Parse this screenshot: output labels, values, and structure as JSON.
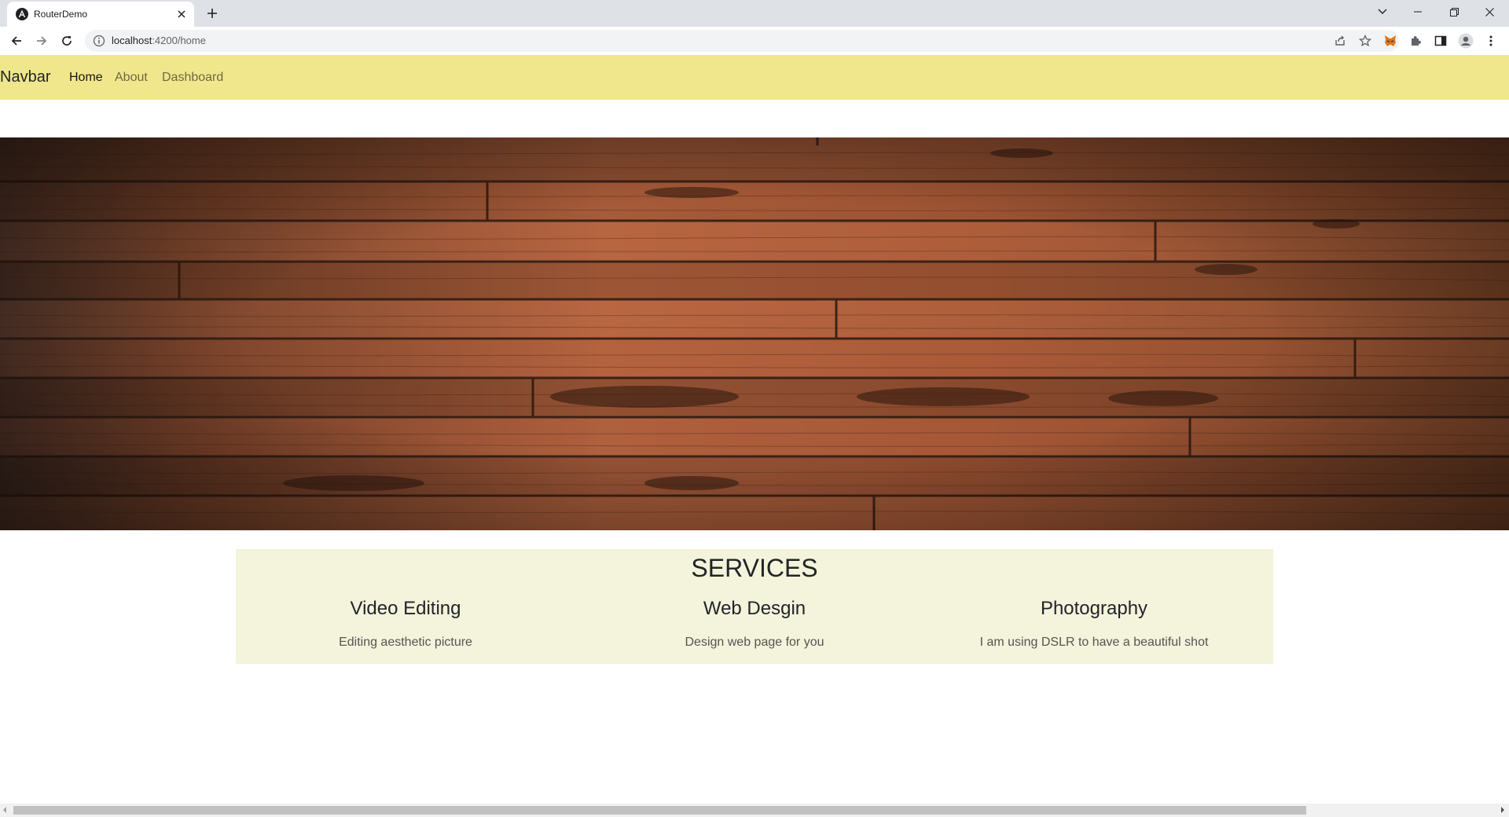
{
  "browser": {
    "tab": {
      "title": "RouterDemo"
    },
    "url": {
      "host": "localhost",
      "rest": ":4200/home"
    }
  },
  "navbar": {
    "brand": "Navbar",
    "links": [
      {
        "label": "Home",
        "active": true
      },
      {
        "label": "About",
        "active": false
      },
      {
        "label": "Dashboard",
        "active": false
      }
    ]
  },
  "hero": {
    "image": "wooden-floor-planks"
  },
  "services": {
    "title": "SERVICES",
    "items": [
      {
        "title": "Video Editing",
        "description": "Editing aesthetic picture"
      },
      {
        "title": "Web Desgin",
        "description": "Design web page for you"
      },
      {
        "title": "Photography",
        "description": "I am using DSLR to have a beautiful shot"
      }
    ]
  },
  "colors": {
    "navbar_bg": "#f0e68c",
    "services_bg": "#f4f3db",
    "tabstrip_bg": "#dee1e6"
  }
}
